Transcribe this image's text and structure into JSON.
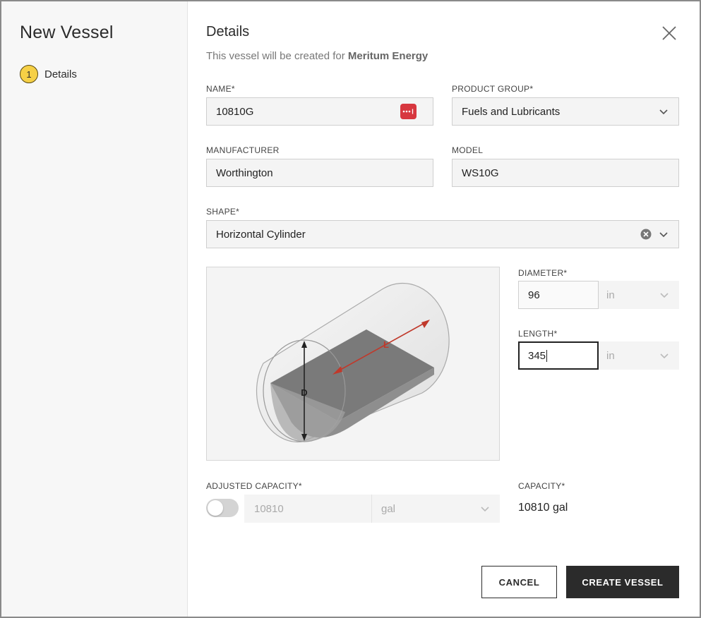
{
  "sidebar": {
    "title": "New Vessel",
    "steps": [
      {
        "number": "1",
        "label": "Details"
      }
    ]
  },
  "header": {
    "title": "Details",
    "subtitle_prefix": "This vessel will be created for",
    "company": "Meritum Energy"
  },
  "form": {
    "name": {
      "label": "NAME*",
      "value": "10810G"
    },
    "product_group": {
      "label": "PRODUCT GROUP*",
      "value": "Fuels and Lubricants"
    },
    "manufacturer": {
      "label": "MANUFACTURER",
      "value": "Worthington"
    },
    "model": {
      "label": "MODEL",
      "value": "WS10G"
    },
    "shape": {
      "label": "SHAPE*",
      "value": "Horizontal Cylinder"
    },
    "diameter": {
      "label": "DIAMETER*",
      "value": "96",
      "unit": "in"
    },
    "length": {
      "label": "LENGTH*",
      "value": "345",
      "unit": "in"
    },
    "adjusted_capacity": {
      "label": "ADJUSTED CAPACITY*",
      "value": "10810",
      "unit": "gal",
      "enabled": false
    },
    "capacity": {
      "label": "CAPACITY*",
      "value": "10810 gal"
    }
  },
  "diagram": {
    "diameter_letter": "D",
    "length_letter": "L"
  },
  "actions": {
    "cancel": "CANCEL",
    "create": "CREATE VESSEL"
  },
  "colors": {
    "accent": "#f6d046",
    "badge": "#d7373f",
    "dark": "#2b2b2b",
    "arrow": "#c0392b"
  },
  "icons": [
    "close-icon",
    "chevron-down-icon",
    "clear-icon",
    "password-manager-icon"
  ]
}
